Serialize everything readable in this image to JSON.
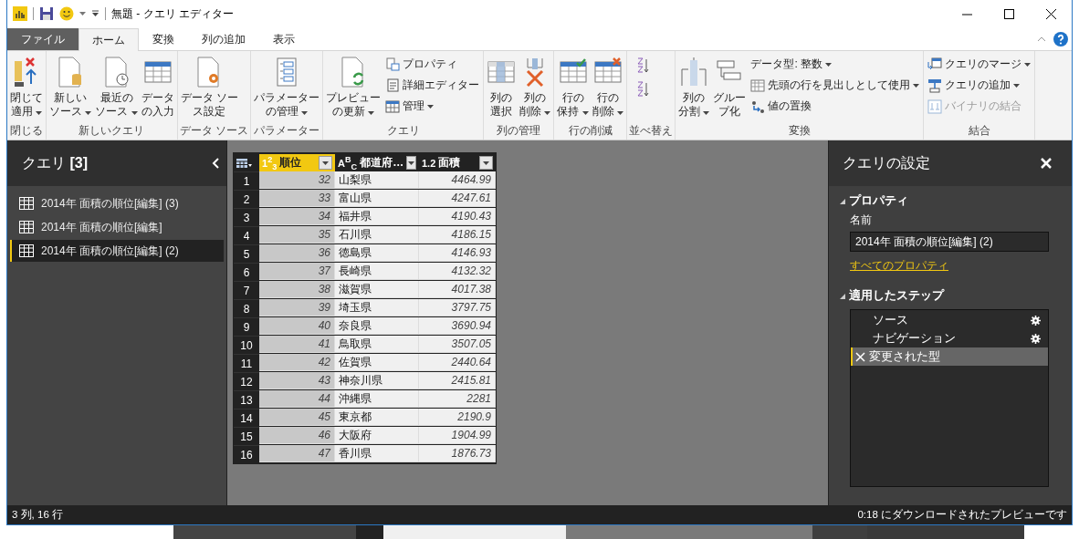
{
  "window": {
    "title": "無題 - クエリ エディター"
  },
  "tabs": [
    {
      "label": "ファイル",
      "kind": "file",
      "selected": false
    },
    {
      "label": "ホーム",
      "kind": "tab",
      "selected": true
    },
    {
      "label": "変換",
      "kind": "tab",
      "selected": false
    },
    {
      "label": "列の追加",
      "kind": "tab",
      "selected": false
    },
    {
      "label": "表示",
      "kind": "tab",
      "selected": false
    }
  ],
  "ribbon": [
    {
      "label": "閉じる",
      "items": [
        {
          "kind": "large",
          "lines": [
            "閉じて",
            "適用"
          ],
          "dropdown": true
        }
      ]
    },
    {
      "label": "新しいクエリ",
      "items": [
        {
          "kind": "large",
          "lines": [
            "新しい",
            "ソース"
          ],
          "dropdown": true
        },
        {
          "kind": "large",
          "lines": [
            "最近の",
            "ソース"
          ],
          "dropdown": true
        },
        {
          "kind": "large",
          "lines": [
            "データ",
            "の入力"
          ],
          "dropdown": false
        }
      ]
    },
    {
      "label": "データ ソース",
      "items": [
        {
          "kind": "large",
          "lines": [
            "データ ソー",
            "ス設定"
          ],
          "dropdown": false
        }
      ]
    },
    {
      "label": "パラメーター",
      "items": [
        {
          "kind": "large",
          "lines": [
            "パラメーター",
            "の管理"
          ],
          "dropdown": true
        }
      ]
    },
    {
      "label": "クエリ",
      "items": [
        {
          "kind": "large",
          "lines": [
            "プレビュー",
            "の更新"
          ],
          "dropdown": true
        },
        {
          "kind": "stack",
          "items": [
            {
              "label": "プロパティ",
              "dropdown": false,
              "disabled": false
            },
            {
              "label": "詳細エディター",
              "dropdown": false,
              "disabled": false
            },
            {
              "label": "管理",
              "dropdown": true,
              "disabled": false
            }
          ]
        }
      ]
    },
    {
      "label": "列の管理",
      "items": [
        {
          "kind": "large",
          "lines": [
            "列の",
            "選択"
          ],
          "dropdown": false
        },
        {
          "kind": "large",
          "lines": [
            "列の",
            "削除"
          ],
          "dropdown": true
        }
      ]
    },
    {
      "label": "行の削減",
      "items": [
        {
          "kind": "large",
          "lines": [
            "行の",
            "保持"
          ],
          "dropdown": true
        },
        {
          "kind": "large",
          "lines": [
            "行の",
            "削除"
          ],
          "dropdown": true
        }
      ]
    },
    {
      "label": "並べ替え",
      "items": [
        {
          "kind": "sort"
        }
      ]
    },
    {
      "label": "変換",
      "items": [
        {
          "kind": "large",
          "lines": [
            "列の",
            "分割"
          ],
          "dropdown": true
        },
        {
          "kind": "large",
          "lines": [
            "グルー",
            "プ化"
          ],
          "dropdown": false
        },
        {
          "kind": "stack",
          "items": [
            {
              "label": "データ型: 整数",
              "dropdown": true,
              "disabled": false
            },
            {
              "label": "先頭の行を見出しとして使用",
              "dropdown": true,
              "disabled": false
            },
            {
              "label": "値の置換",
              "dropdown": false,
              "disabled": false
            }
          ]
        }
      ]
    },
    {
      "label": "結合",
      "items": [
        {
          "kind": "stack",
          "items": [
            {
              "label": "クエリのマージ",
              "dropdown": true,
              "disabled": false
            },
            {
              "label": "クエリの追加",
              "dropdown": true,
              "disabled": false
            },
            {
              "label": "バイナリの結合",
              "dropdown": false,
              "disabled": true
            }
          ]
        }
      ]
    }
  ],
  "queries": {
    "title": "クエリ",
    "count": "[3]",
    "items": [
      {
        "label": "2014年 面積の順位[編集] (3)",
        "selected": false
      },
      {
        "label": "2014年 面積の順位[編集]",
        "selected": false
      },
      {
        "label": "2014年 面積の順位[編集] (2)",
        "selected": true
      }
    ]
  },
  "table": {
    "columns": [
      {
        "type_label": "1$^{2}$$_{3}$",
        "label": "順位",
        "selected": true,
        "kind": "number"
      },
      {
        "type_label": "A$^{B}$$_{C}$",
        "label": "都道府…",
        "selected": false,
        "kind": "text"
      },
      {
        "type_label": "1.2",
        "label": "面積",
        "selected": false,
        "kind": "number"
      }
    ],
    "rows": [
      {
        "number": "1",
        "cells": [
          "32",
          "山梨県",
          "4464.99"
        ]
      },
      {
        "number": "2",
        "cells": [
          "33",
          "富山県",
          "4247.61"
        ]
      },
      {
        "number": "3",
        "cells": [
          "34",
          "福井県",
          "4190.43"
        ]
      },
      {
        "number": "4",
        "cells": [
          "35",
          "石川県",
          "4186.15"
        ]
      },
      {
        "number": "5",
        "cells": [
          "36",
          "徳島県",
          "4146.93"
        ]
      },
      {
        "number": "6",
        "cells": [
          "37",
          "長崎県",
          "4132.32"
        ]
      },
      {
        "number": "7",
        "cells": [
          "38",
          "滋賀県",
          "4017.38"
        ]
      },
      {
        "number": "8",
        "cells": [
          "39",
          "埼玉県",
          "3797.75"
        ]
      },
      {
        "number": "9",
        "cells": [
          "40",
          "奈良県",
          "3690.94"
        ]
      },
      {
        "number": "10",
        "cells": [
          "41",
          "鳥取県",
          "3507.05"
        ]
      },
      {
        "number": "11",
        "cells": [
          "42",
          "佐賀県",
          "2440.64"
        ]
      },
      {
        "number": "12",
        "cells": [
          "43",
          "神奈川県",
          "2415.81"
        ]
      },
      {
        "number": "13",
        "cells": [
          "44",
          "沖縄県",
          "2281"
        ]
      },
      {
        "number": "14",
        "cells": [
          "45",
          "東京都",
          "2190.9"
        ]
      },
      {
        "number": "15",
        "cells": [
          "46",
          "大阪府",
          "1904.99"
        ]
      },
      {
        "number": "16",
        "cells": [
          "47",
          "香川県",
          "1876.73"
        ]
      }
    ]
  },
  "settings": {
    "title": "クエリの設定",
    "properties_heading": "プロパティ",
    "name_label": "名前",
    "name_value": "2014年 面積の順位[編集] (2)",
    "all_properties_link": "すべてのプロパティ",
    "steps_heading": "適用したステップ",
    "steps": [
      {
        "label": "ソース",
        "has_settings": true,
        "selected": false
      },
      {
        "label": "ナビゲーション",
        "has_settings": true,
        "selected": false
      },
      {
        "label": "変更された型",
        "has_settings": false,
        "selected": true
      }
    ]
  },
  "status_bar": {
    "left": "3 列, 16 行",
    "right": "0:18 にダウンロードされたプレビューです"
  }
}
